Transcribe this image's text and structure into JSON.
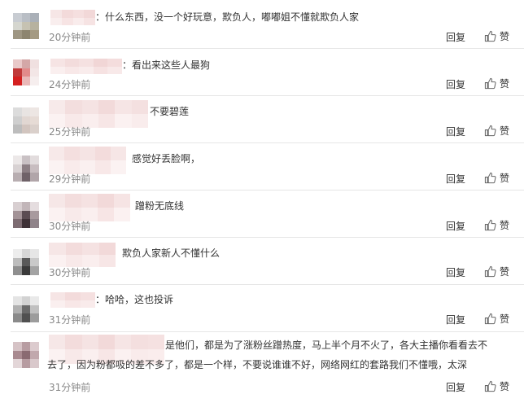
{
  "comments": [
    {
      "text": "：什么东西，没一个好玩意，欺负人，嘟嘟姐不懂就欺负人家",
      "time": "20分钟前"
    },
    {
      "text": "：看出来这些人最狗",
      "time": "24分钟前"
    },
    {
      "text": "不要碧莲",
      "time": "25分钟前"
    },
    {
      "text": "感觉好丢脸啊，",
      "time": "29分钟前"
    },
    {
      "text": "蹭粉无底线",
      "time": "30分钟前"
    },
    {
      "text": "欺负人家新人不懂什么",
      "time": "30分钟前"
    },
    {
      "text": "：哈哈，这也投诉",
      "time": "31分钟前"
    },
    {
      "line1": "是他们，都是为了涨粉丝蹭热度，马上半个月不火了，各大主播你看看去不",
      "line2": "去了，因为粉都吸的差不多了，都是一个样，不要说谁谁不好，网络网红的套路我们不懂哦，太深",
      "time": "31分钟前"
    }
  ],
  "actions": {
    "reply": "回复",
    "like": "赞"
  },
  "icons": {
    "like": "thumbs-up-icon"
  }
}
